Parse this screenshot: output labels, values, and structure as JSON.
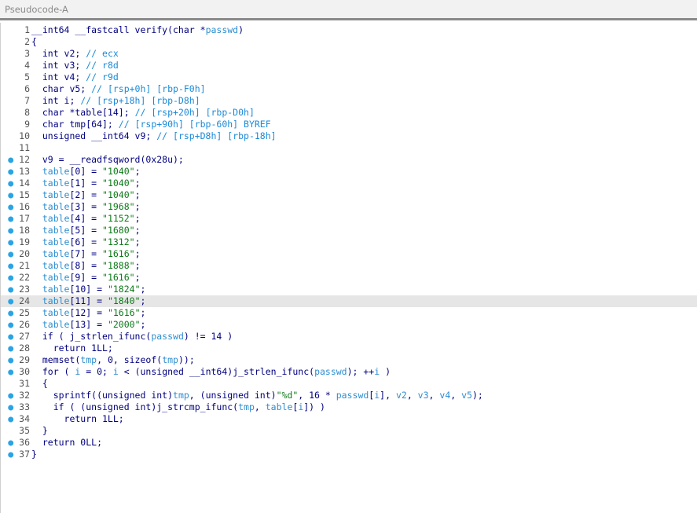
{
  "window": {
    "title": "Pseudocode-A"
  },
  "editor": {
    "gutter_dot": "●",
    "lines": [
      {
        "num": "1",
        "dot": false,
        "text": "__int64 __fastcall verify(char *passwd)"
      },
      {
        "num": "2",
        "dot": false,
        "text": "{"
      },
      {
        "num": "3",
        "dot": false,
        "text": "  int v2; // ecx"
      },
      {
        "num": "4",
        "dot": false,
        "text": "  int v3; // r8d"
      },
      {
        "num": "5",
        "dot": false,
        "text": "  int v4; // r9d"
      },
      {
        "num": "6",
        "dot": false,
        "text": "  char v5; // [rsp+0h] [rbp-F0h]"
      },
      {
        "num": "7",
        "dot": false,
        "text": "  int i; // [rsp+18h] [rbp-D8h]"
      },
      {
        "num": "8",
        "dot": false,
        "text": "  char *table[14]; // [rsp+20h] [rbp-D0h]"
      },
      {
        "num": "9",
        "dot": false,
        "text": "  char tmp[64]; // [rsp+90h] [rbp-60h] BYREF"
      },
      {
        "num": "10",
        "dot": false,
        "text": "  unsigned __int64 v9; // [rsp+D8h] [rbp-18h]"
      },
      {
        "num": "11",
        "dot": false,
        "text": ""
      },
      {
        "num": "12",
        "dot": true,
        "text": "  v9 = __readfsqword(0x28u);"
      },
      {
        "num": "13",
        "dot": true,
        "text": "  table[0] = \"1040\";"
      },
      {
        "num": "14",
        "dot": true,
        "text": "  table[1] = \"1040\";"
      },
      {
        "num": "15",
        "dot": true,
        "text": "  table[2] = \"1040\";"
      },
      {
        "num": "16",
        "dot": true,
        "text": "  table[3] = \"1968\";"
      },
      {
        "num": "17",
        "dot": true,
        "text": "  table[4] = \"1152\";"
      },
      {
        "num": "18",
        "dot": true,
        "text": "  table[5] = \"1680\";"
      },
      {
        "num": "19",
        "dot": true,
        "text": "  table[6] = \"1312\";"
      },
      {
        "num": "20",
        "dot": true,
        "text": "  table[7] = \"1616\";"
      },
      {
        "num": "21",
        "dot": true,
        "text": "  table[8] = \"1888\";"
      },
      {
        "num": "22",
        "dot": true,
        "text": "  table[9] = \"1616\";"
      },
      {
        "num": "23",
        "dot": true,
        "text": "  table[10] = \"1824\";"
      },
      {
        "num": "24",
        "dot": true,
        "text": "  table[11] = \"1840\";",
        "highlighted": true
      },
      {
        "num": "25",
        "dot": true,
        "text": "  table[12] = \"1616\";"
      },
      {
        "num": "26",
        "dot": true,
        "text": "  table[13] = \"2000\";"
      },
      {
        "num": "27",
        "dot": true,
        "text": "  if ( j_strlen_ifunc(passwd) != 14 )"
      },
      {
        "num": "28",
        "dot": true,
        "text": "    return 1LL;"
      },
      {
        "num": "29",
        "dot": true,
        "text": "  memset(tmp, 0, sizeof(tmp));"
      },
      {
        "num": "30",
        "dot": true,
        "text": "  for ( i = 0; i < (unsigned __int64)j_strlen_ifunc(passwd); ++i )"
      },
      {
        "num": "31",
        "dot": false,
        "text": "  {"
      },
      {
        "num": "32",
        "dot": true,
        "text": "    sprintf((unsigned int)tmp, (unsigned int)\"%d\", 16 * passwd[i], v2, v3, v4, v5);"
      },
      {
        "num": "33",
        "dot": true,
        "text": "    if ( (unsigned int)j_strcmp_ifunc(tmp, table[i]) )"
      },
      {
        "num": "34",
        "dot": true,
        "text": "      return 1LL;"
      },
      {
        "num": "35",
        "dot": false,
        "text": "  }"
      },
      {
        "num": "36",
        "dot": true,
        "text": "  return 0LL;"
      },
      {
        "num": "37",
        "dot": true,
        "text": "}"
      }
    ]
  },
  "colors": {
    "keyword": "#000080",
    "comment": "#1b8ad9",
    "string": "#0c7a18",
    "variable": "#2e8ecf",
    "breakpoint_dot": "#2aa4e4",
    "highlight_line": "#e6e6e6"
  }
}
